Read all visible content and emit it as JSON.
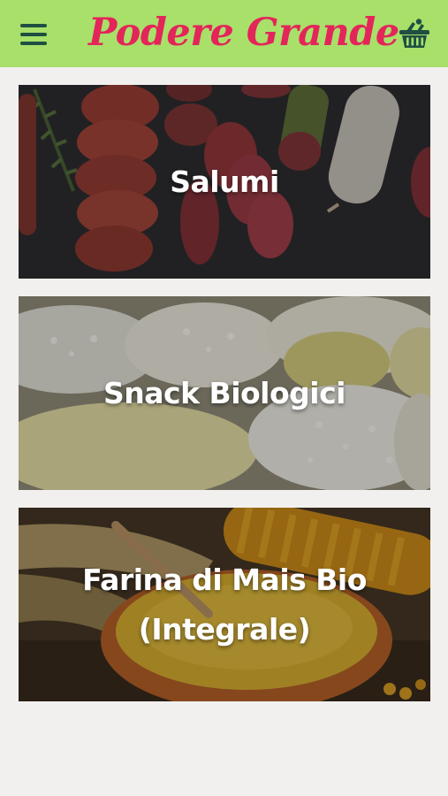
{
  "app": {
    "title": "Podere Grande",
    "colors": {
      "header_bg": "#a8e06a",
      "brand": "#e3255a",
      "icon": "#1f4f43",
      "page_bg": "#f1f0ee"
    }
  },
  "header": {
    "menu_icon": "hamburger-menu-icon",
    "cart_icon": "shopping-basket-icon"
  },
  "categories": [
    {
      "label": "Salumi",
      "image": "cured-meats-photo"
    },
    {
      "label": "Snack Biologici",
      "image": "rice-cakes-photo"
    },
    {
      "label": "Farina di Mais Bio\n(Integrale)",
      "image": "corn-flour-photo"
    }
  ]
}
